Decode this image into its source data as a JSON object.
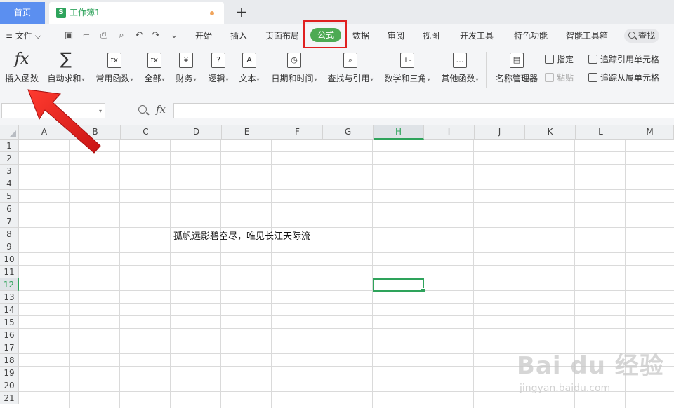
{
  "tabs": {
    "home": "首页",
    "document": "工作簿1",
    "document_icon": "S",
    "new_tab": "+"
  },
  "menubar": {
    "file": "≡ 文件 ⌵",
    "items": [
      "开始",
      "插入",
      "页面布局",
      "公式",
      "数据",
      "审阅",
      "视图",
      "开发工具",
      "特色功能",
      "智能工具箱"
    ],
    "active": "公式",
    "search": "查找"
  },
  "ribbon": {
    "insert_function": "插入函数",
    "fx_symbol": "fx",
    "sigma_symbol": "∑",
    "groups": [
      {
        "label": "自动求和",
        "icon": "sum-icon"
      },
      {
        "label": "常用函数",
        "icon": "fx-star-icon"
      },
      {
        "label": "全部",
        "icon": "fx-book-icon"
      },
      {
        "label": "财务",
        "icon": "yen-book-icon"
      },
      {
        "label": "逻辑",
        "icon": "question-book-icon"
      },
      {
        "label": "文本",
        "icon": "a-book-icon"
      },
      {
        "label": "日期和时间",
        "icon": "clock-book-icon"
      },
      {
        "label": "查找与引用",
        "icon": "search-book-icon"
      },
      {
        "label": "数学和三角",
        "icon": "math-book-icon"
      },
      {
        "label": "其他函数",
        "icon": "dots-book-icon"
      },
      {
        "label": "名称管理器",
        "icon": "name-manager-icon"
      }
    ],
    "icon_glyphs": [
      "",
      "fx",
      "fx",
      "¥",
      "?",
      "A",
      "◷",
      "⌕",
      "+-",
      "…",
      "▤"
    ],
    "define": "指定",
    "paste": "粘贴",
    "trace_precedents": "追踪引用单元格",
    "trace_dependents": "追踪从属单元格"
  },
  "formula_bar": {
    "fx_symbol": "fx",
    "name_box": "",
    "formula": ""
  },
  "sheet": {
    "columns": [
      "A",
      "B",
      "C",
      "D",
      "E",
      "F",
      "G",
      "H",
      "I",
      "J",
      "K",
      "L",
      "M"
    ],
    "rows": [
      "1",
      "2",
      "3",
      "4",
      "5",
      "6",
      "7",
      "8",
      "9",
      "10",
      "11",
      "12",
      "13",
      "14",
      "15",
      "16",
      "17",
      "18",
      "19",
      "20",
      "21"
    ],
    "selected_column": "H",
    "selected_row": "12",
    "cell_D8": "孤帆远影碧空尽，唯见长江天际流"
  },
  "watermark": {
    "main": "Bai du 经验",
    "sub": "jingyan.baidu.com"
  },
  "colors": {
    "accent": "#2ea35b",
    "tab_blue": "#5b8ff0",
    "highlight_red": "#e02020"
  }
}
